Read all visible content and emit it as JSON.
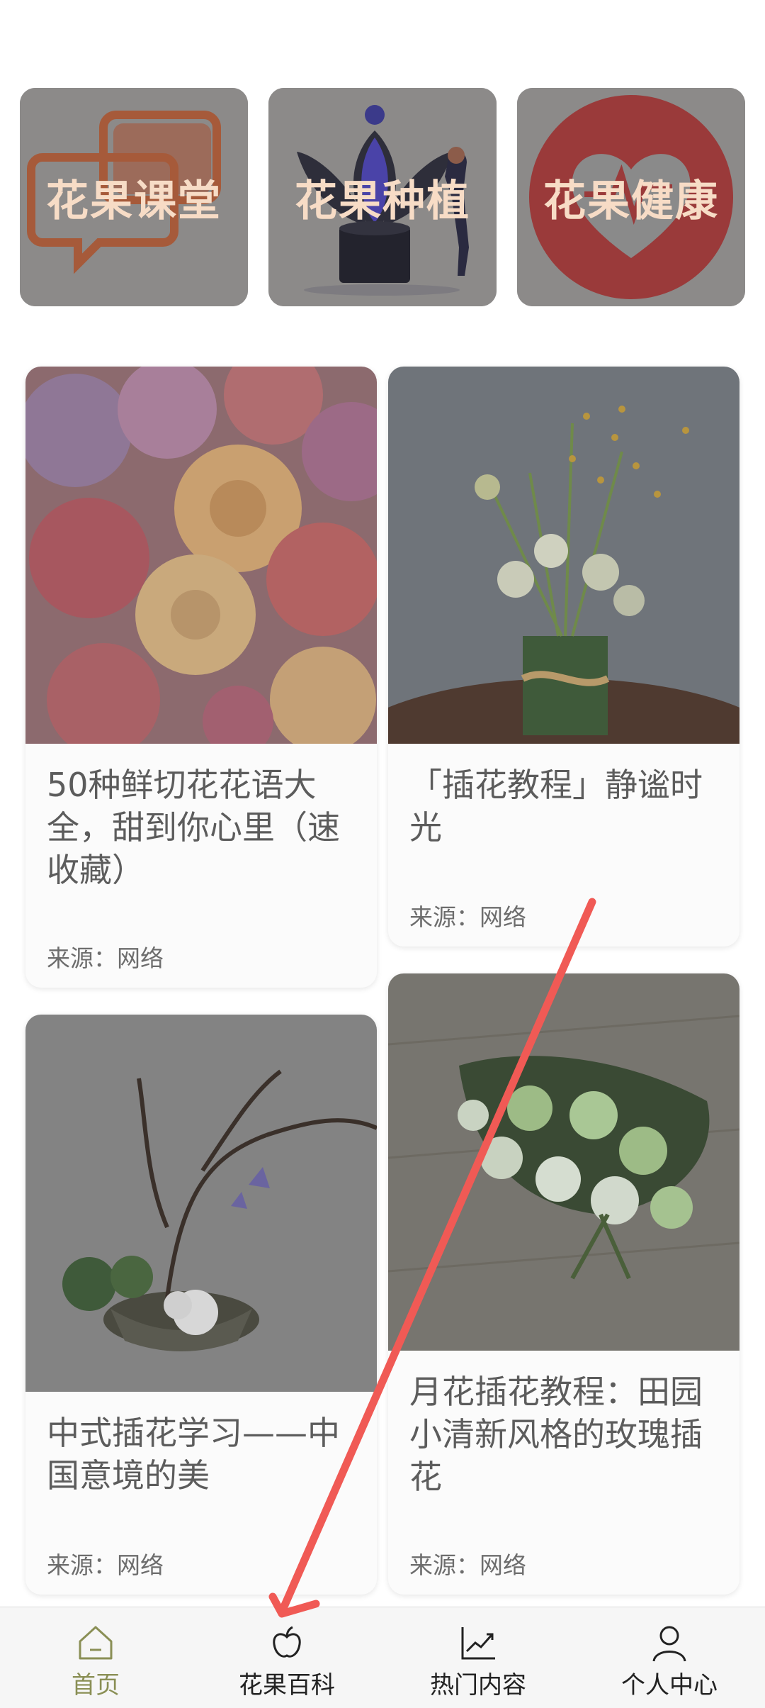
{
  "categories": [
    {
      "label": "花果课堂",
      "icon": "chat-bubbles-art"
    },
    {
      "label": "花果种植",
      "icon": "planting-art"
    },
    {
      "label": "花果健康",
      "icon": "heart-art"
    }
  ],
  "cards": [
    {
      "title": "50种鲜切花花语大全，甜到你心里（速收藏）",
      "source": "来源：网络",
      "image": "roses-image"
    },
    {
      "title": "「插花教程」静谧时光",
      "source": "来源：网络",
      "image": "vase-flowers-image"
    },
    {
      "title": "中式插花学习——中国意境的美",
      "source": "来源：网络",
      "image": "ikebana-image"
    },
    {
      "title": "月花插花教程：田园小清新风格的玫瑰插花",
      "source": "来源：网络",
      "image": "green-roses-image"
    }
  ],
  "nav": {
    "items": [
      {
        "label": "首页",
        "icon": "home-icon",
        "active": true
      },
      {
        "label": "花果百科",
        "icon": "apple-icon",
        "active": false
      },
      {
        "label": "热门内容",
        "icon": "trend-chart-icon",
        "active": false
      },
      {
        "label": "个人中心",
        "icon": "person-icon",
        "active": false
      }
    ]
  },
  "colors": {
    "accent": "#8a8f55",
    "overlay": "#8a8a8a",
    "annotation_arrow": "#f05a55"
  }
}
